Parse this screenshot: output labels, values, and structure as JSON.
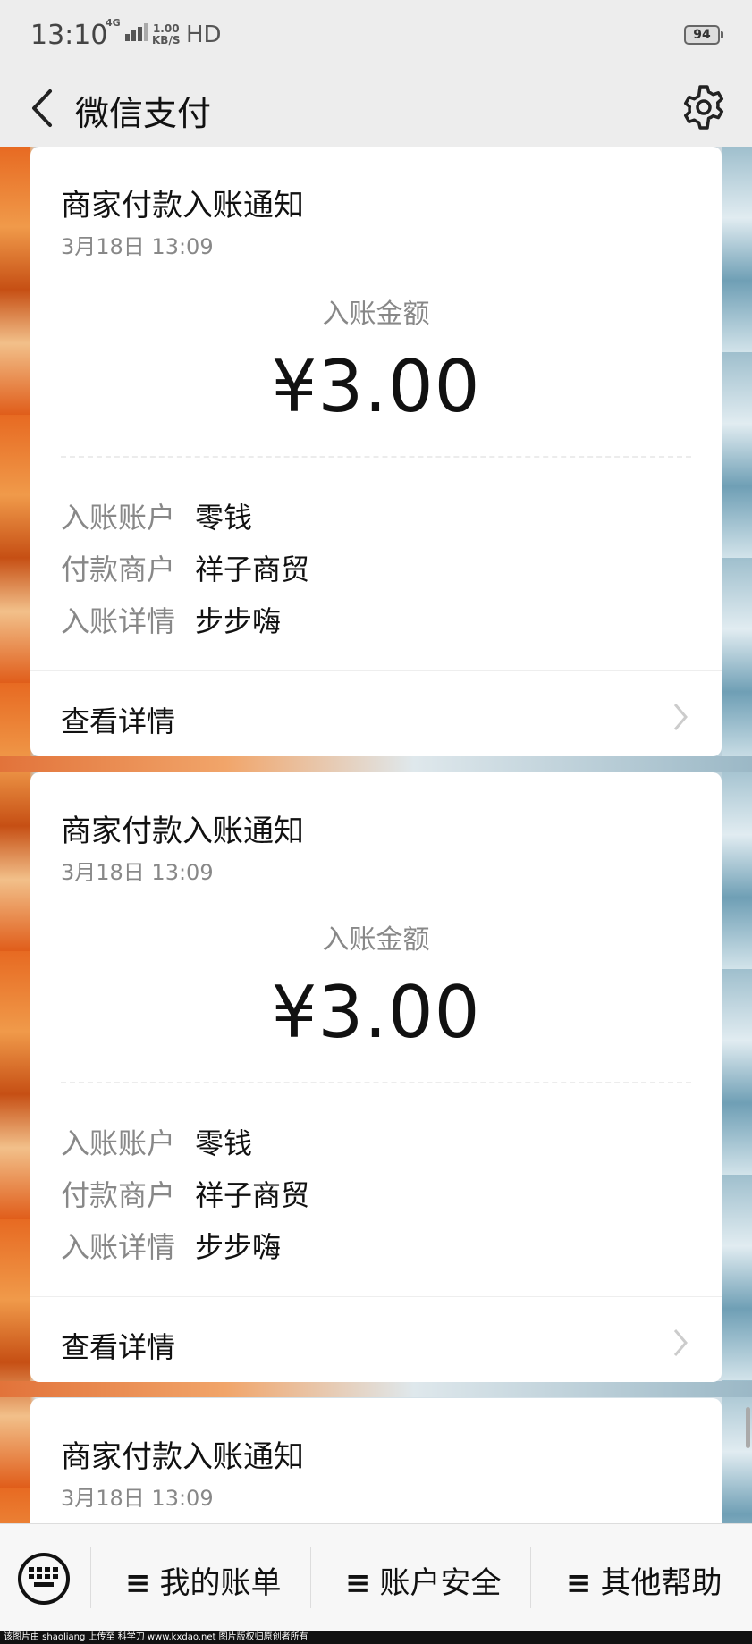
{
  "status_bar": {
    "time": "13:10",
    "network": "4G",
    "speed_value": "1.00",
    "speed_unit": "KB/S",
    "hd": "HD",
    "battery": "94"
  },
  "nav": {
    "title": "微信支付",
    "back_icon": "chevron-left-icon",
    "settings_icon": "gear-icon"
  },
  "messages": [
    {
      "title": "商家付款入账通知",
      "time": "3月18日  13:09",
      "amount_label": "入账金额",
      "amount": "¥3.00",
      "fields": [
        {
          "label": "入账账户",
          "value": "零钱"
        },
        {
          "label": "付款商户",
          "value": "祥子商贸"
        },
        {
          "label": "入账详情",
          "value": "步步嗨"
        }
      ],
      "detail_link": "查看详情"
    },
    {
      "title": "商家付款入账通知",
      "time": "3月18日  13:09",
      "amount_label": "入账金额",
      "amount": "¥3.00",
      "fields": [
        {
          "label": "入账账户",
          "value": "零钱"
        },
        {
          "label": "付款商户",
          "value": "祥子商贸"
        },
        {
          "label": "入账详情",
          "value": "步步嗨"
        }
      ],
      "detail_link": "查看详情"
    },
    {
      "title": "商家付款入账通知",
      "time": "3月18日  13:09"
    }
  ],
  "bottom_menu": {
    "keyboard_icon": "keyboard-icon",
    "items": [
      "我的账单",
      "账户安全",
      "其他帮助"
    ],
    "menu_icon": "≡"
  },
  "footer_text": "该图片由 shaoliang 上传至 科学刀 www.kxdao.net 图片版权归原创者所有"
}
